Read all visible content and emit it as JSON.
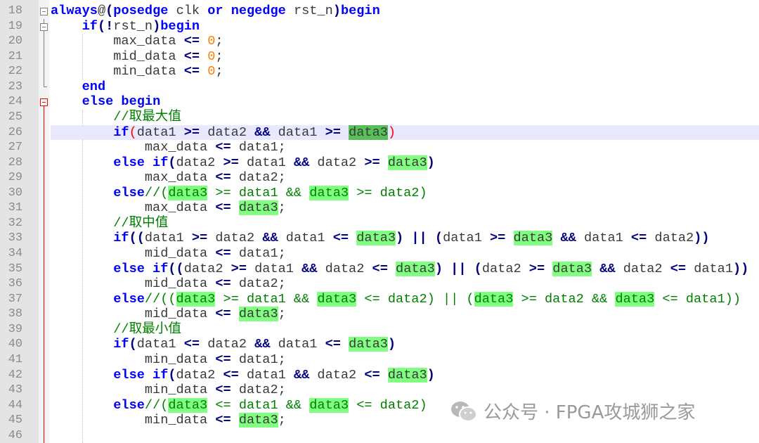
{
  "editor": {
    "current_line": 26,
    "lines": [
      {
        "n": "18",
        "tokens": [
          [
            "always",
            "k"
          ],
          [
            "@",
            "t"
          ],
          [
            "(",
            "o"
          ],
          [
            "posedge",
            "k"
          ],
          [
            " clk ",
            "t"
          ],
          [
            "or",
            "k"
          ],
          [
            " ",
            "t"
          ],
          [
            "negedge",
            "k"
          ],
          [
            " rst_n",
            "t"
          ],
          [
            ")",
            "o"
          ],
          [
            "begin",
            "k"
          ]
        ]
      },
      {
        "n": "19",
        "tokens": [
          [
            "    ",
            "t"
          ],
          [
            "if",
            "k"
          ],
          [
            "(!",
            "o"
          ],
          [
            "rst_n",
            "t"
          ],
          [
            ")",
            "o"
          ],
          [
            "begin",
            "k"
          ]
        ]
      },
      {
        "n": "20",
        "tokens": [
          [
            "        max_data ",
            "t"
          ],
          [
            "<=",
            "o"
          ],
          [
            " ",
            "t"
          ],
          [
            "0",
            "n"
          ],
          [
            ";",
            "t"
          ]
        ]
      },
      {
        "n": "21",
        "tokens": [
          [
            "        mid_data ",
            "t"
          ],
          [
            "<=",
            "o"
          ],
          [
            " ",
            "t"
          ],
          [
            "0",
            "n"
          ],
          [
            ";",
            "t"
          ]
        ]
      },
      {
        "n": "22",
        "tokens": [
          [
            "        min_data ",
            "t"
          ],
          [
            "<=",
            "o"
          ],
          [
            " ",
            "t"
          ],
          [
            "0",
            "n"
          ],
          [
            ";",
            "t"
          ]
        ]
      },
      {
        "n": "23",
        "tokens": [
          [
            "    ",
            "t"
          ],
          [
            "end",
            "k"
          ]
        ]
      },
      {
        "n": "24",
        "tokens": [
          [
            "    ",
            "t"
          ],
          [
            "else begin",
            "k"
          ]
        ]
      },
      {
        "n": "25",
        "tokens": [
          [
            "        ",
            "t"
          ],
          [
            "//取最大值",
            "c"
          ]
        ]
      },
      {
        "n": "26",
        "tokens": [
          [
            "        ",
            "t"
          ],
          [
            "if",
            "k"
          ],
          [
            "(",
            "r"
          ],
          [
            "data1 ",
            "t"
          ],
          [
            ">=",
            "o"
          ],
          [
            " data2 ",
            "t"
          ],
          [
            "&&",
            "o"
          ],
          [
            " data1 ",
            "t"
          ],
          [
            ">=",
            "o"
          ],
          [
            " ",
            "t"
          ],
          [
            "data3",
            "hh"
          ],
          [
            ")",
            "r"
          ]
        ]
      },
      {
        "n": "27",
        "tokens": [
          [
            "            max_data ",
            "t"
          ],
          [
            "<=",
            "o"
          ],
          [
            " data1;",
            "t"
          ]
        ]
      },
      {
        "n": "28",
        "tokens": [
          [
            "        ",
            "t"
          ],
          [
            "else if",
            "k"
          ],
          [
            "(",
            "o"
          ],
          [
            "data2 ",
            "t"
          ],
          [
            ">=",
            "o"
          ],
          [
            " data1 ",
            "t"
          ],
          [
            "&&",
            "o"
          ],
          [
            " data2 ",
            "t"
          ],
          [
            ">=",
            "o"
          ],
          [
            " ",
            "t"
          ],
          [
            "data3",
            "h"
          ],
          [
            ")",
            "o"
          ]
        ]
      },
      {
        "n": "29",
        "tokens": [
          [
            "            max_data ",
            "t"
          ],
          [
            "<=",
            "o"
          ],
          [
            " data2;",
            "t"
          ]
        ]
      },
      {
        "n": "30",
        "tokens": [
          [
            "        ",
            "t"
          ],
          [
            "else",
            "k"
          ],
          [
            "//(",
            "c"
          ],
          [
            "data3",
            "hc"
          ],
          [
            " >= data1 && ",
            "c"
          ],
          [
            "data3",
            "hc"
          ],
          [
            " >= data2)",
            "c"
          ]
        ]
      },
      {
        "n": "31",
        "tokens": [
          [
            "            max_data ",
            "t"
          ],
          [
            "<=",
            "o"
          ],
          [
            " ",
            "t"
          ],
          [
            "data3",
            "h"
          ],
          [
            ";",
            "t"
          ]
        ]
      },
      {
        "n": "32",
        "tokens": [
          [
            "        ",
            "t"
          ],
          [
            "//取中值",
            "c"
          ]
        ]
      },
      {
        "n": "33",
        "tokens": [
          [
            "        ",
            "t"
          ],
          [
            "if",
            "k"
          ],
          [
            "((",
            "o"
          ],
          [
            "data1 ",
            "t"
          ],
          [
            ">=",
            "o"
          ],
          [
            " data2 ",
            "t"
          ],
          [
            "&&",
            "o"
          ],
          [
            " data1 ",
            "t"
          ],
          [
            "<=",
            "o"
          ],
          [
            " ",
            "t"
          ],
          [
            "data3",
            "h"
          ],
          [
            ")",
            "o"
          ],
          [
            " ",
            "t"
          ],
          [
            "||",
            "o"
          ],
          [
            " ",
            "t"
          ],
          [
            "(",
            "o"
          ],
          [
            "data1 ",
            "t"
          ],
          [
            ">=",
            "o"
          ],
          [
            " ",
            "t"
          ],
          [
            "data3",
            "h"
          ],
          [
            " ",
            "t"
          ],
          [
            "&&",
            "o"
          ],
          [
            " data1 ",
            "t"
          ],
          [
            "<=",
            "o"
          ],
          [
            " data2",
            "t"
          ],
          [
            "))",
            "o"
          ]
        ]
      },
      {
        "n": "34",
        "tokens": [
          [
            "            mid_data ",
            "t"
          ],
          [
            "<=",
            "o"
          ],
          [
            " data1;",
            "t"
          ]
        ]
      },
      {
        "n": "35",
        "tokens": [
          [
            "        ",
            "t"
          ],
          [
            "else if",
            "k"
          ],
          [
            "((",
            "o"
          ],
          [
            "data2 ",
            "t"
          ],
          [
            ">=",
            "o"
          ],
          [
            " data1 ",
            "t"
          ],
          [
            "&&",
            "o"
          ],
          [
            " data2 ",
            "t"
          ],
          [
            "<=",
            "o"
          ],
          [
            " ",
            "t"
          ],
          [
            "data3",
            "h"
          ],
          [
            ")",
            "o"
          ],
          [
            " ",
            "t"
          ],
          [
            "||",
            "o"
          ],
          [
            " ",
            "t"
          ],
          [
            "(",
            "o"
          ],
          [
            "data2 ",
            "t"
          ],
          [
            ">=",
            "o"
          ],
          [
            " ",
            "t"
          ],
          [
            "data3",
            "h"
          ],
          [
            " ",
            "t"
          ],
          [
            "&&",
            "o"
          ],
          [
            " data2 ",
            "t"
          ],
          [
            "<=",
            "o"
          ],
          [
            " data1",
            "t"
          ],
          [
            "))",
            "o"
          ]
        ]
      },
      {
        "n": "36",
        "tokens": [
          [
            "            mid_data ",
            "t"
          ],
          [
            "<=",
            "o"
          ],
          [
            " data2;",
            "t"
          ]
        ]
      },
      {
        "n": "37",
        "tokens": [
          [
            "        ",
            "t"
          ],
          [
            "else",
            "k"
          ],
          [
            "//((",
            "c"
          ],
          [
            "data3",
            "hc"
          ],
          [
            " >= data1 && ",
            "c"
          ],
          [
            "data3",
            "hc"
          ],
          [
            " <= data2) || (",
            "c"
          ],
          [
            "data3",
            "hc"
          ],
          [
            " >= data2 && ",
            "c"
          ],
          [
            "data3",
            "hc"
          ],
          [
            " <= data1))",
            "c"
          ]
        ]
      },
      {
        "n": "38",
        "tokens": [
          [
            "            mid_data ",
            "t"
          ],
          [
            "<=",
            "o"
          ],
          [
            " ",
            "t"
          ],
          [
            "data3",
            "h"
          ],
          [
            ";",
            "t"
          ]
        ]
      },
      {
        "n": "39",
        "tokens": [
          [
            "        ",
            "t"
          ],
          [
            "//取最小值",
            "c"
          ]
        ]
      },
      {
        "n": "40",
        "tokens": [
          [
            "        ",
            "t"
          ],
          [
            "if",
            "k"
          ],
          [
            "(",
            "o"
          ],
          [
            "data1 ",
            "t"
          ],
          [
            "<=",
            "o"
          ],
          [
            " data2 ",
            "t"
          ],
          [
            "&&",
            "o"
          ],
          [
            " data1 ",
            "t"
          ],
          [
            "<=",
            "o"
          ],
          [
            " ",
            "t"
          ],
          [
            "data3",
            "h"
          ],
          [
            ")",
            "o"
          ]
        ]
      },
      {
        "n": "41",
        "tokens": [
          [
            "            min_data ",
            "t"
          ],
          [
            "<=",
            "o"
          ],
          [
            " data1;",
            "t"
          ]
        ]
      },
      {
        "n": "42",
        "tokens": [
          [
            "        ",
            "t"
          ],
          [
            "else if",
            "k"
          ],
          [
            "(",
            "o"
          ],
          [
            "data2 ",
            "t"
          ],
          [
            "<=",
            "o"
          ],
          [
            " data1 ",
            "t"
          ],
          [
            "&&",
            "o"
          ],
          [
            " data2 ",
            "t"
          ],
          [
            "<=",
            "o"
          ],
          [
            " ",
            "t"
          ],
          [
            "data3",
            "h"
          ],
          [
            ")",
            "o"
          ]
        ]
      },
      {
        "n": "43",
        "tokens": [
          [
            "            min_data ",
            "t"
          ],
          [
            "<=",
            "o"
          ],
          [
            " data2;",
            "t"
          ]
        ]
      },
      {
        "n": "44",
        "tokens": [
          [
            "        ",
            "t"
          ],
          [
            "else",
            "k"
          ],
          [
            "//(",
            "c"
          ],
          [
            "data3",
            "hc"
          ],
          [
            " <= data1 && ",
            "c"
          ],
          [
            "data3",
            "hc"
          ],
          [
            " <= data2)",
            "c"
          ]
        ]
      },
      {
        "n": "45",
        "tokens": [
          [
            "            min_data ",
            "t"
          ],
          [
            "<=",
            "o"
          ],
          [
            " ",
            "t"
          ],
          [
            "data3",
            "h"
          ],
          [
            ";",
            "t"
          ]
        ]
      },
      {
        "n": "46",
        "tokens": []
      }
    ],
    "fold_markers": {
      "18": "box",
      "19": "box",
      "24": "box-red"
    }
  },
  "watermark": {
    "icon": "wechat-icon",
    "text": "公众号 · FPGA攻城狮之家"
  },
  "colors": {
    "keyword": "#0000ff",
    "operator": "#000080",
    "number": "#ff8000",
    "comment": "#008000",
    "highlight": "#80ff80",
    "current_line": "#e8e8ff"
  }
}
